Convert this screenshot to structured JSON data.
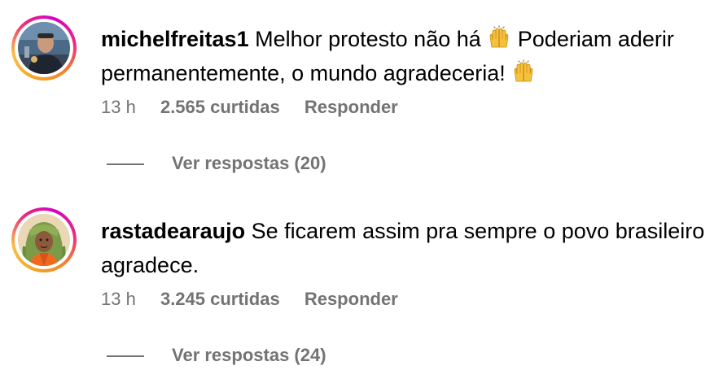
{
  "comments": [
    {
      "username": "michelfreitas1",
      "text_part1": " Melhor protesto não há ",
      "text_part2": " Poderiam aderir permanentemente, o mundo agradeceria! ",
      "emoji_icon": "raising-hands-icon",
      "time": "13 h",
      "likes": "2.565 curtidas",
      "reply_label": "Responder",
      "view_replies": "Ver respostas (20)"
    },
    {
      "username": "rastadearaujo",
      "text": " Se ficarem assim pra sempre o povo brasileiro agradece.",
      "time": "13 h",
      "likes": "3.245 curtidas",
      "reply_label": "Responder",
      "view_replies": "Ver respostas (24)"
    }
  ],
  "colors": {
    "meta_text": "#737373",
    "story_ring_start": "#f5a623",
    "story_ring_end": "#d300c5"
  }
}
